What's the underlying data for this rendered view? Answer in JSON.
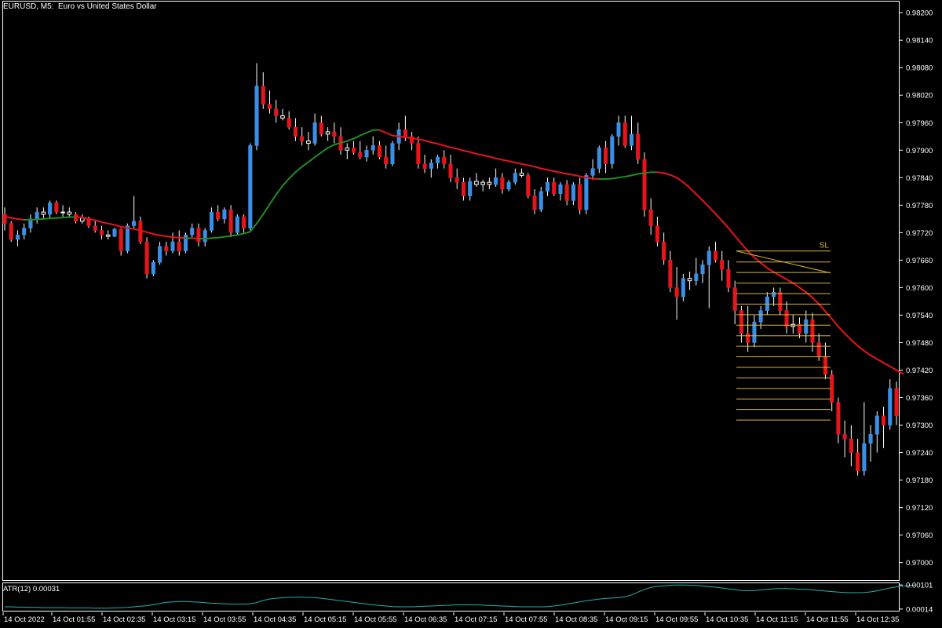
{
  "chart_data": {
    "type": "candlestick",
    "title": "EURUSD, M5:  Euro vs United States Dollar",
    "y_ticks": [
      "0.98200",
      "0.98140",
      "0.98080",
      "0.98020",
      "0.97960",
      "0.97900",
      "0.97840",
      "0.97780",
      "0.97720",
      "0.97660",
      "0.97600",
      "0.97540",
      "0.97480",
      "0.97420",
      "0.97360",
      "0.97300",
      "0.97240",
      "0.97180",
      "0.97120",
      "0.97060",
      "0.97000"
    ],
    "ylim": [
      0.9696,
      0.98226
    ],
    "x_ticks": [
      "14 Oct 2022",
      "14 Oct 01:55",
      "14 Oct 02:35",
      "14 Oct 03:15",
      "14 Oct 03:55",
      "14 Oct 04:35",
      "14 Oct 05:15",
      "14 Oct 05:55",
      "14 Oct 06:35",
      "14 Oct 07:15",
      "14 Oct 07:55",
      "14 Oct 08:35",
      "14 Oct 09:15",
      "14 Oct 09:55",
      "14 Oct 10:35",
      "14 Oct 11:15",
      "14 Oct 11:55",
      "14 Oct 12:35"
    ],
    "colors": {
      "background": "#000000",
      "bull_body": "#3a8ee6",
      "bear_body": "#e8141b",
      "doji_body": "#ffffff",
      "ma_up": "#228b22",
      "ma_down": "#e8141b",
      "grid_lines": "#d4b43a",
      "atr": "#20b2aa",
      "axis": "#ffffff"
    },
    "candles": [
      [
        0.9776,
        0.97775,
        0.97725,
        0.9774
      ],
      [
        0.9774,
        0.97745,
        0.977,
        0.97705
      ],
      [
        0.97705,
        0.97725,
        0.9769,
        0.97715
      ],
      [
        0.97715,
        0.9774,
        0.97705,
        0.9773
      ],
      [
        0.9773,
        0.9776,
        0.9772,
        0.9775
      ],
      [
        0.9775,
        0.97775,
        0.9774,
        0.97765
      ],
      [
        0.97765,
        0.97775,
        0.9775,
        0.9776
      ],
      [
        0.9776,
        0.9779,
        0.9775,
        0.97785
      ],
      [
        0.97785,
        0.9779,
        0.9776,
        0.97765
      ],
      [
        0.97765,
        0.9778,
        0.97755,
        0.97765
      ],
      [
        0.97765,
        0.97775,
        0.97755,
        0.9776
      ],
      [
        0.9776,
        0.97765,
        0.9774,
        0.97745
      ],
      [
        0.97745,
        0.9776,
        0.9774,
        0.97752
      ],
      [
        0.97752,
        0.97755,
        0.9773,
        0.97735
      ],
      [
        0.97735,
        0.97745,
        0.9772,
        0.97725
      ],
      [
        0.97725,
        0.97735,
        0.97705,
        0.97715
      ],
      [
        0.97715,
        0.97725,
        0.97705,
        0.97712
      ],
      [
        0.97712,
        0.9773,
        0.9771,
        0.97728
      ],
      [
        0.97728,
        0.9773,
        0.9767,
        0.9768
      ],
      [
        0.9768,
        0.9774,
        0.97675,
        0.97735
      ],
      [
        0.97735,
        0.978,
        0.9773,
        0.97745
      ],
      [
        0.97745,
        0.97755,
        0.97695,
        0.977
      ],
      [
        0.977,
        0.9771,
        0.9762,
        0.9763
      ],
      [
        0.9763,
        0.9766,
        0.97625,
        0.97655
      ],
      [
        0.97655,
        0.977,
        0.9765,
        0.9769
      ],
      [
        0.9769,
        0.977,
        0.9767,
        0.9768
      ],
      [
        0.9768,
        0.9772,
        0.97675,
        0.977
      ],
      [
        0.977,
        0.97725,
        0.9767,
        0.9768
      ],
      [
        0.9768,
        0.9772,
        0.97675,
        0.97715
      ],
      [
        0.97715,
        0.9774,
        0.9771,
        0.9773
      ],
      [
        0.9773,
        0.9774,
        0.9769,
        0.977
      ],
      [
        0.977,
        0.9773,
        0.9769,
        0.97725
      ],
      [
        0.97725,
        0.97775,
        0.9772,
        0.97765
      ],
      [
        0.97765,
        0.9778,
        0.97745,
        0.9775
      ],
      [
        0.9775,
        0.97775,
        0.9774,
        0.9777
      ],
      [
        0.9777,
        0.9778,
        0.9771,
        0.9772
      ],
      [
        0.9772,
        0.9776,
        0.97715,
        0.97755
      ],
      [
        0.97755,
        0.9776,
        0.9772,
        0.9773
      ],
      [
        0.9773,
        0.97915,
        0.97725,
        0.9791
      ],
      [
        0.9791,
        0.9809,
        0.979,
        0.9804
      ],
      [
        0.9804,
        0.9807,
        0.9799,
        0.98
      ],
      [
        0.98,
        0.9803,
        0.9798,
        0.9799
      ],
      [
        0.9799,
        0.9801,
        0.9796,
        0.97975
      ],
      [
        0.97975,
        0.9799,
        0.97965,
        0.9797
      ],
      [
        0.9797,
        0.97985,
        0.97945,
        0.9795
      ],
      [
        0.9795,
        0.9797,
        0.9792,
        0.9793
      ],
      [
        0.9793,
        0.9795,
        0.9791,
        0.9792
      ],
      [
        0.9792,
        0.9794,
        0.979,
        0.97915
      ],
      [
        0.97915,
        0.9798,
        0.9791,
        0.9796
      ],
      [
        0.9796,
        0.97975,
        0.9793,
        0.97935
      ],
      [
        0.97935,
        0.9795,
        0.9792,
        0.9794
      ],
      [
        0.9794,
        0.9796,
        0.97915,
        0.9793
      ],
      [
        0.9793,
        0.9795,
        0.9789,
        0.979
      ],
      [
        0.979,
        0.97915,
        0.9788,
        0.97905
      ],
      [
        0.97905,
        0.9792,
        0.9789,
        0.97895
      ],
      [
        0.97895,
        0.9792,
        0.9788,
        0.97885
      ],
      [
        0.97885,
        0.9791,
        0.97875,
        0.979
      ],
      [
        0.979,
        0.9793,
        0.9789,
        0.9791
      ],
      [
        0.9791,
        0.9792,
        0.9788,
        0.97885
      ],
      [
        0.97885,
        0.9791,
        0.9786,
        0.9787
      ],
      [
        0.9787,
        0.9792,
        0.97865,
        0.97915
      ],
      [
        0.97915,
        0.9796,
        0.979,
        0.97945
      ],
      [
        0.97945,
        0.97975,
        0.9792,
        0.9793
      ],
      [
        0.9793,
        0.9794,
        0.979,
        0.97915
      ],
      [
        0.97915,
        0.9793,
        0.9786,
        0.9787
      ],
      [
        0.9787,
        0.9789,
        0.9785,
        0.9786
      ],
      [
        0.9786,
        0.9788,
        0.9784,
        0.97872
      ],
      [
        0.97872,
        0.9789,
        0.9786,
        0.97885
      ],
      [
        0.97885,
        0.979,
        0.9786,
        0.9787
      ],
      [
        0.9787,
        0.9789,
        0.9783,
        0.9784
      ],
      [
        0.9784,
        0.9786,
        0.97815,
        0.9783
      ],
      [
        0.9783,
        0.9784,
        0.9779,
        0.978
      ],
      [
        0.978,
        0.9784,
        0.9779,
        0.97832
      ],
      [
        0.97832,
        0.9785,
        0.9782,
        0.97825
      ],
      [
        0.97825,
        0.97835,
        0.9781,
        0.9783
      ],
      [
        0.9783,
        0.9784,
        0.97815,
        0.97825
      ],
      [
        0.97825,
        0.9786,
        0.9782,
        0.9784
      ],
      [
        0.9784,
        0.9785,
        0.97805,
        0.97815
      ],
      [
        0.97815,
        0.97835,
        0.9781,
        0.9783
      ],
      [
        0.9783,
        0.9786,
        0.97825,
        0.9785
      ],
      [
        0.9785,
        0.9786,
        0.9784,
        0.97845
      ],
      [
        0.97845,
        0.9785,
        0.97795,
        0.978
      ],
      [
        0.978,
        0.97815,
        0.9776,
        0.9777
      ],
      [
        0.9777,
        0.9782,
        0.97765,
        0.9781
      ],
      [
        0.9781,
        0.9784,
        0.978,
        0.9783
      ],
      [
        0.9783,
        0.9784,
        0.978,
        0.97805
      ],
      [
        0.97805,
        0.9783,
        0.9779,
        0.97825
      ],
      [
        0.97825,
        0.97835,
        0.9778,
        0.9779
      ],
      [
        0.9779,
        0.9783,
        0.9778,
        0.97825
      ],
      [
        0.97825,
        0.9784,
        0.9776,
        0.9777
      ],
      [
        0.9777,
        0.9785,
        0.9776,
        0.97845
      ],
      [
        0.97845,
        0.9788,
        0.97835,
        0.9786
      ],
      [
        0.9786,
        0.9791,
        0.9785,
        0.97905
      ],
      [
        0.97905,
        0.9792,
        0.9785,
        0.9787
      ],
      [
        0.9787,
        0.97935,
        0.9786,
        0.9793
      ],
      [
        0.9793,
        0.97975,
        0.9791,
        0.9796
      ],
      [
        0.9796,
        0.97975,
        0.97905,
        0.9791
      ],
      [
        0.9791,
        0.97975,
        0.979,
        0.97935
      ],
      [
        0.97935,
        0.9796,
        0.9787,
        0.9788
      ],
      [
        0.9788,
        0.97895,
        0.97755,
        0.9777
      ],
      [
        0.9777,
        0.97795,
        0.97715,
        0.97735
      ],
      [
        0.97735,
        0.97755,
        0.9769,
        0.977
      ],
      [
        0.977,
        0.9772,
        0.9765,
        0.9766
      ],
      [
        0.9766,
        0.9768,
        0.9759,
        0.976
      ],
      [
        0.976,
        0.97645,
        0.9753,
        0.9758
      ],
      [
        0.9758,
        0.9763,
        0.9757,
        0.9762
      ],
      [
        0.9762,
        0.97635,
        0.97595,
        0.97615
      ],
      [
        0.97615,
        0.97665,
        0.97605,
        0.9763
      ],
      [
        0.9763,
        0.9766,
        0.9761,
        0.9765
      ],
      [
        0.9765,
        0.9769,
        0.97555,
        0.9768
      ],
      [
        0.9768,
        0.977,
        0.97655,
        0.9766
      ],
      [
        0.9766,
        0.9768,
        0.97615,
        0.9764
      ],
      [
        0.9764,
        0.9766,
        0.9759,
        0.976
      ],
      [
        0.976,
        0.97615,
        0.9752,
        0.9755
      ],
      [
        0.9755,
        0.9756,
        0.9748,
        0.975
      ],
      [
        0.975,
        0.9756,
        0.9746,
        0.9748
      ],
      [
        0.9748,
        0.9754,
        0.9747,
        0.97525
      ],
      [
        0.97525,
        0.9756,
        0.9751,
        0.9755
      ],
      [
        0.9755,
        0.9759,
        0.9754,
        0.9758
      ],
      [
        0.9758,
        0.976,
        0.9756,
        0.9759
      ],
      [
        0.9759,
        0.976,
        0.9754,
        0.9755
      ],
      [
        0.9755,
        0.9757,
        0.975,
        0.97515
      ],
      [
        0.97515,
        0.9754,
        0.975,
        0.9752
      ],
      [
        0.9752,
        0.97535,
        0.9749,
        0.975
      ],
      [
        0.975,
        0.9755,
        0.9748,
        0.9753
      ],
      [
        0.9753,
        0.97545,
        0.9746,
        0.9748
      ],
      [
        0.9748,
        0.975,
        0.9744,
        0.9745
      ],
      [
        0.9745,
        0.9748,
        0.974,
        0.9741
      ],
      [
        0.9741,
        0.9742,
        0.9733,
        0.9735
      ],
      [
        0.9735,
        0.9736,
        0.9726,
        0.9728
      ],
      [
        0.9728,
        0.9731,
        0.9723,
        0.9727
      ],
      [
        0.9727,
        0.973,
        0.9721,
        0.9724
      ],
      [
        0.9724,
        0.9727,
        0.9719,
        0.972
      ],
      [
        0.972,
        0.9735,
        0.9719,
        0.9726
      ],
      [
        0.9726,
        0.973,
        0.9722,
        0.9728
      ],
      [
        0.9728,
        0.9733,
        0.9724,
        0.9732
      ],
      [
        0.9732,
        0.9734,
        0.9725,
        0.973
      ],
      [
        0.973,
        0.974,
        0.9729,
        0.9738
      ],
      [
        0.9738,
        0.97395,
        0.973,
        0.9732
      ]
    ],
    "moving_average": [
      0.97755,
      0.97752,
      0.9775,
      0.97748,
      0.97748,
      0.97749,
      0.9775,
      0.97751,
      0.97752,
      0.97753,
      0.97754,
      0.97754,
      0.97753,
      0.9775,
      0.97747,
      0.97743,
      0.9774,
      0.97737,
      0.97733,
      0.9773,
      0.97728,
      0.97725,
      0.97721,
      0.97717,
      0.97714,
      0.97712,
      0.9771,
      0.97709,
      0.97708,
      0.97708,
      0.97707,
      0.97707,
      0.97708,
      0.97709,
      0.97711,
      0.97713,
      0.97715,
      0.97718,
      0.97722,
      0.9774,
      0.9776,
      0.97782,
      0.97803,
      0.97822,
      0.97838,
      0.97852,
      0.97864,
      0.97874,
      0.97885,
      0.97895,
      0.97905,
      0.97912,
      0.97916,
      0.9792,
      0.97925,
      0.97932,
      0.97938,
      0.97944,
      0.97944,
      0.97938,
      0.97932,
      0.9793,
      0.97928,
      0.97926,
      0.97924,
      0.97921,
      0.97917,
      0.97914,
      0.9791,
      0.97906,
      0.97903,
      0.97899,
      0.97896,
      0.97892,
      0.97889,
      0.97886,
      0.97882,
      0.97879,
      0.97876,
      0.97873,
      0.9787,
      0.97867,
      0.97864,
      0.9786,
      0.97857,
      0.97854,
      0.97851,
      0.97848,
      0.97846,
      0.97843,
      0.9784,
      0.97838,
      0.97837,
      0.97837,
      0.97838,
      0.9784,
      0.97842,
      0.97845,
      0.97848,
      0.9785,
      0.97852,
      0.97852,
      0.9785,
      0.97846,
      0.9784,
      0.9783,
      0.97818,
      0.97804,
      0.9779,
      0.97776,
      0.97761,
      0.97746,
      0.9773,
      0.97713,
      0.97696,
      0.9768,
      0.97666,
      0.97654,
      0.97643,
      0.97634,
      0.97626,
      0.97618,
      0.9761,
      0.976,
      0.9759,
      0.97578,
      0.97564,
      0.97548,
      0.97532,
      0.97515,
      0.975,
      0.97486,
      0.97473,
      0.97462,
      0.97452,
      0.97444,
      0.97436,
      0.97428,
      0.9742,
      0.97412
    ],
    "annotation": {
      "label": "SL",
      "levels": [
        0.9768,
        0.97656,
        0.97633,
        0.9761,
        0.97587,
        0.97564,
        0.97541,
        0.97518,
        0.97495,
        0.97472,
        0.97449,
        0.97426,
        0.97403,
        0.9738,
        0.97357,
        0.97334,
        0.97311
      ],
      "diagonal": [
        0.9768,
        0.97632
      ]
    },
    "indicator": {
      "name": "ATR(12) 0.00031",
      "y_ticks": [
        "0.00101",
        "0.00014"
      ],
      "ylim": [
        5e-05,
        0.0011
      ],
      "values": [
        0.00022,
        0.00022,
        0.00021,
        0.00021,
        0.0002,
        0.0002,
        0.00019,
        0.00019,
        0.00019,
        0.00019,
        0.00018,
        0.00018,
        0.00018,
        0.00018,
        0.00017,
        0.00017,
        0.00017,
        0.00018,
        0.00019,
        0.0002,
        0.00022,
        0.00024,
        0.00026,
        0.0003,
        0.00034,
        0.00038,
        0.0004,
        0.00041,
        0.00041,
        0.0004,
        0.00039,
        0.00037,
        0.00035,
        0.00034,
        0.00033,
        0.00032,
        0.00032,
        0.00032,
        0.00033,
        0.00037,
        0.00045,
        0.0005,
        0.00053,
        0.00055,
        0.00056,
        0.00057,
        0.00057,
        0.00056,
        0.00055,
        0.00053,
        0.0005,
        0.00047,
        0.00044,
        0.00041,
        0.00038,
        0.00035,
        0.00032,
        0.00029,
        0.00027,
        0.00025,
        0.00023,
        0.00022,
        0.00022,
        0.00022,
        0.00023,
        0.00024,
        0.00025,
        0.00026,
        0.00027,
        0.00028,
        0.00029,
        0.00029,
        0.00029,
        0.00029,
        0.00028,
        0.00027,
        0.00026,
        0.00025,
        0.00024,
        0.00023,
        0.00022,
        0.00022,
        0.00022,
        0.00022,
        0.00023,
        0.00025,
        0.00028,
        0.00032,
        0.00036,
        0.0004,
        0.00044,
        0.00047,
        0.0005,
        0.00052,
        0.00054,
        0.00055,
        0.00058,
        0.00065,
        0.00075,
        0.00085,
        0.00092,
        0.00096,
        0.00098,
        0.001,
        0.00101,
        0.00101,
        0.001,
        0.00099,
        0.00097,
        0.00095,
        0.00093,
        0.0009,
        0.00087,
        0.00084,
        0.00081,
        0.0008,
        0.00081,
        0.00083,
        0.00085,
        0.00087,
        0.00088,
        0.00088,
        0.00087,
        0.00086,
        0.00085,
        0.00083,
        0.00081,
        0.00079,
        0.00077,
        0.00075,
        0.00074,
        0.00073,
        0.00073,
        0.00074,
        0.00076,
        0.0008,
        0.00085,
        0.0009,
        0.00094,
        0.00097,
        0.00099,
        0.00101
      ]
    }
  }
}
